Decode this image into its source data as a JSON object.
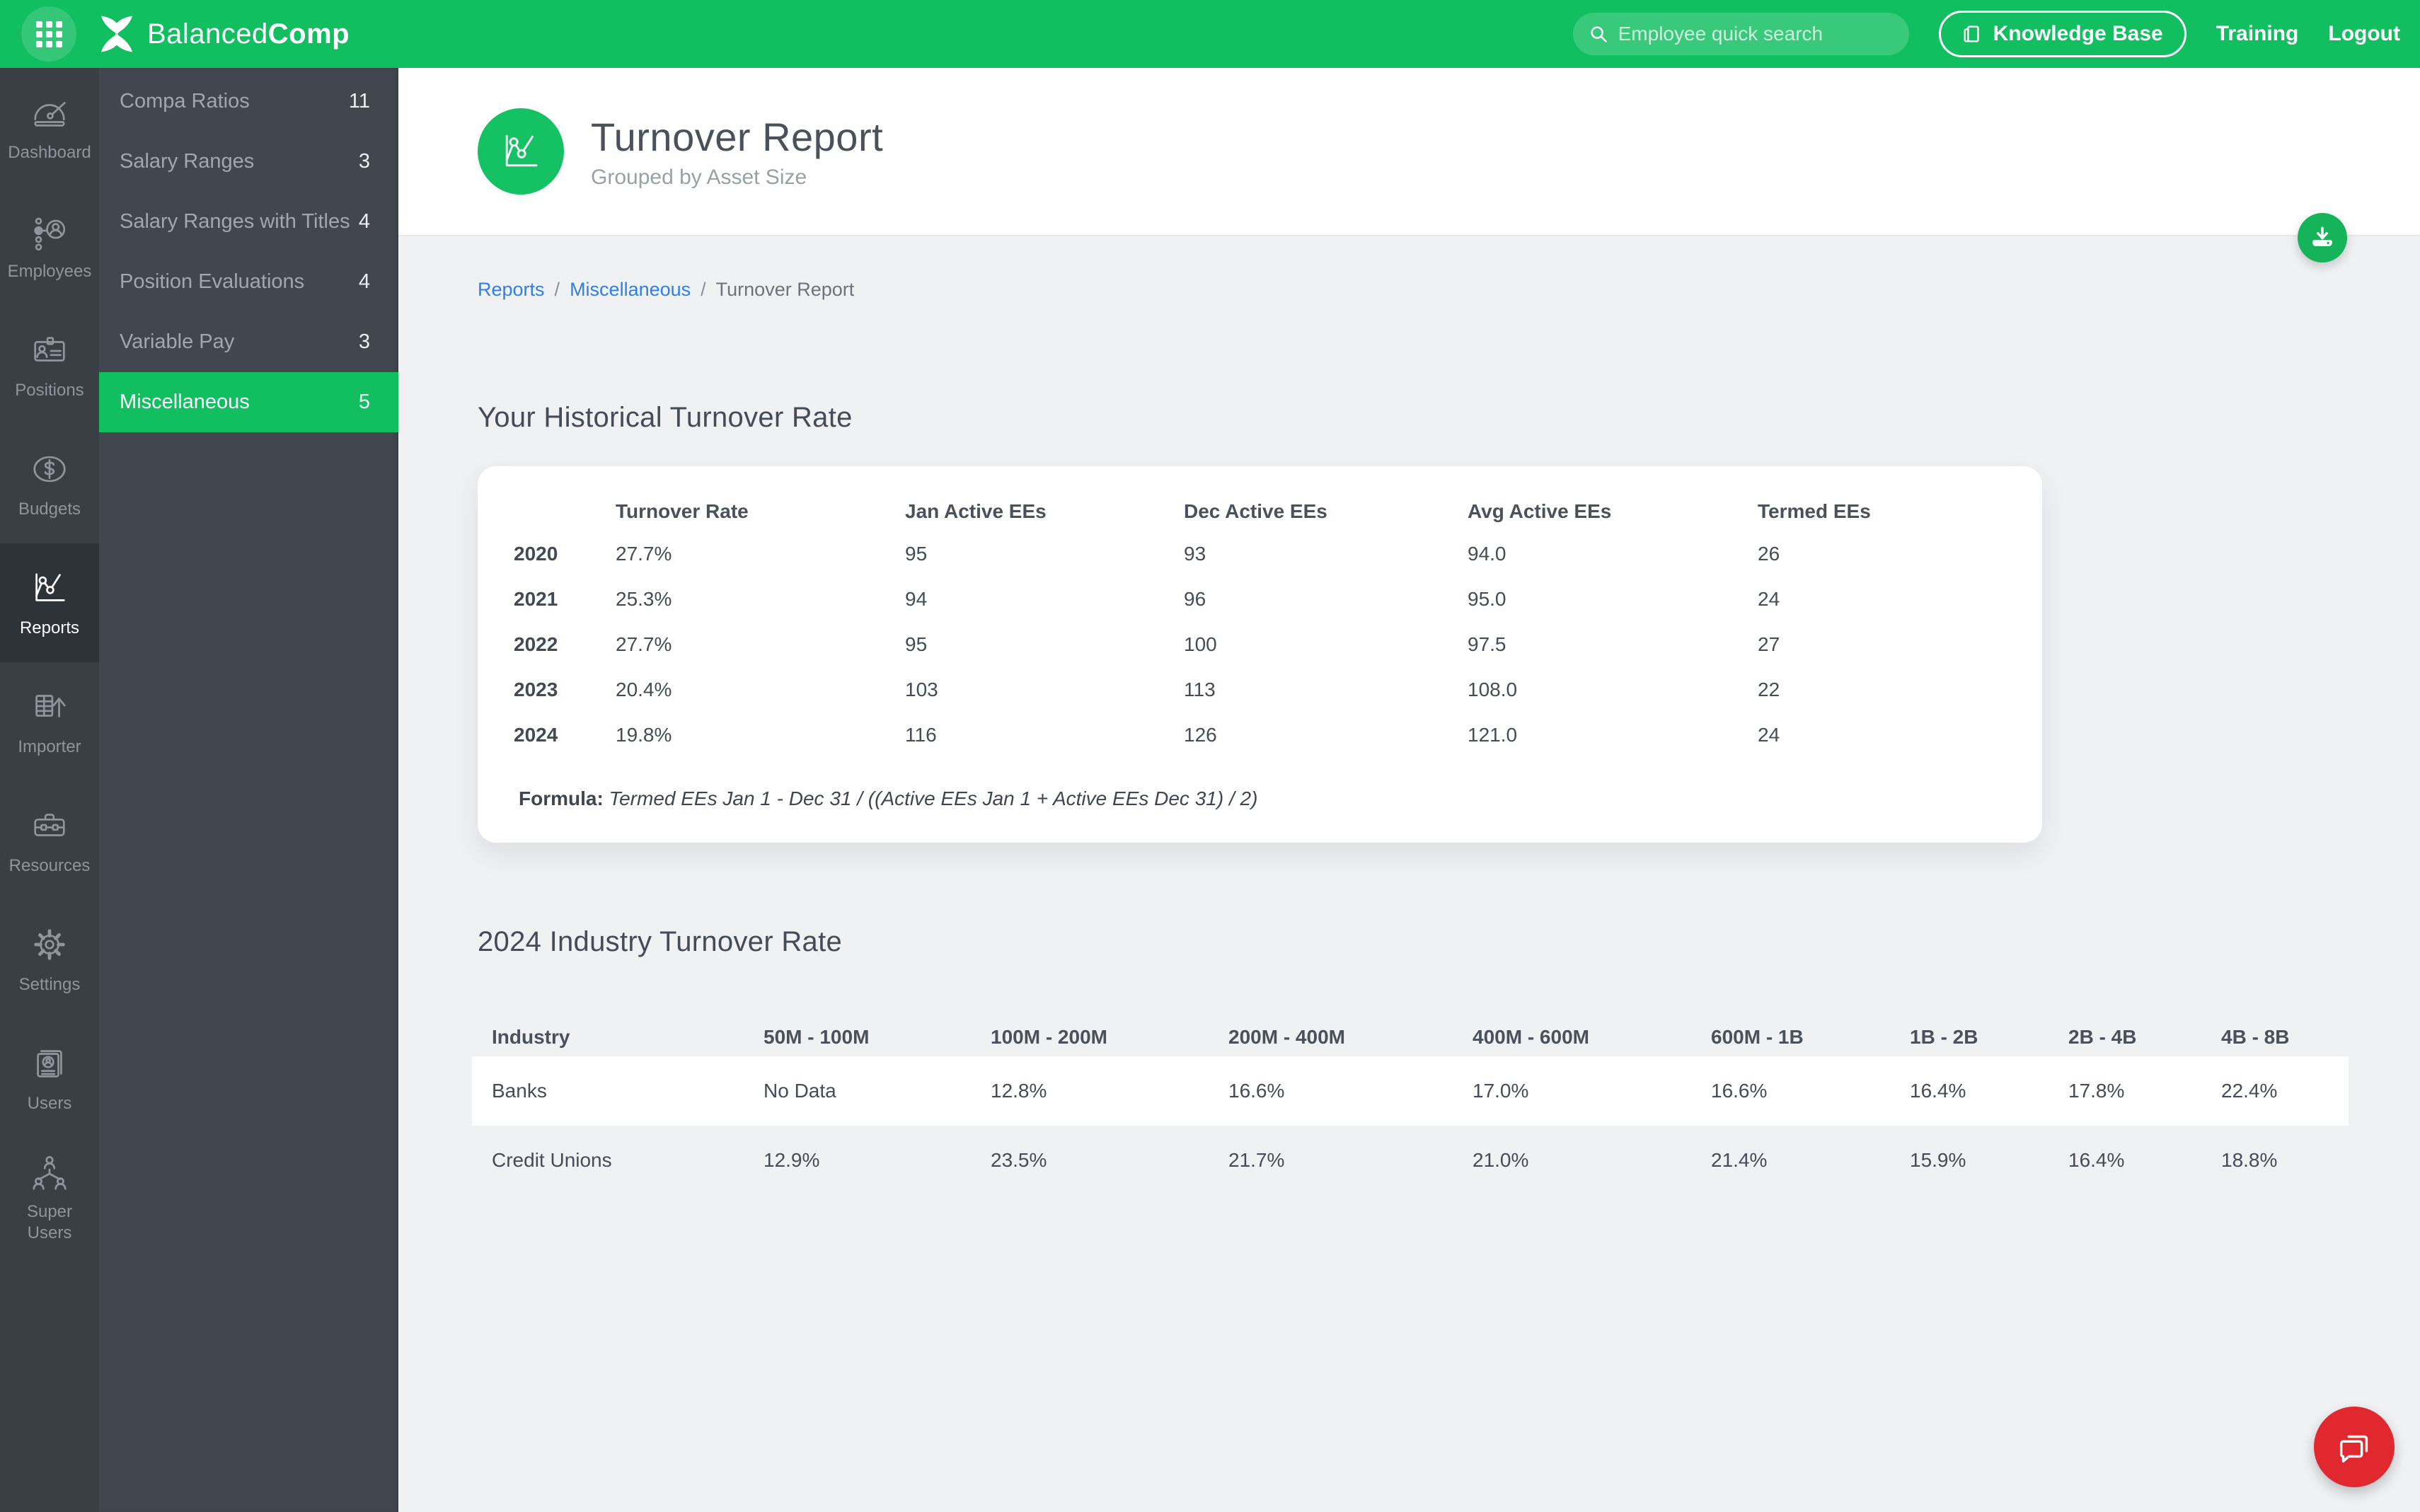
{
  "topbar": {
    "brand_regular": "Balanced",
    "brand_bold": "Comp",
    "search_placeholder": "Employee quick search",
    "knowledge_base_label": "Knowledge Base",
    "training_label": "Training",
    "logout_label": "Logout"
  },
  "sidebar": {
    "items": [
      {
        "label": "Dashboard",
        "icon": "dashboard-gauge",
        "active": false
      },
      {
        "label": "Employees",
        "icon": "employees-org",
        "active": false
      },
      {
        "label": "Positions",
        "icon": "positions-card",
        "active": false
      },
      {
        "label": "Budgets",
        "icon": "budgets-dollar",
        "active": false
      },
      {
        "label": "Reports",
        "icon": "reports-chart",
        "active": true
      },
      {
        "label": "Importer",
        "icon": "importer-sheet",
        "active": false
      },
      {
        "label": "Resources",
        "icon": "resources-briefcase",
        "active": false
      },
      {
        "label": "Settings",
        "icon": "settings-gear",
        "active": false
      },
      {
        "label": "Users",
        "icon": "users-card",
        "active": false
      },
      {
        "label": "Super Users",
        "icon": "super-users-tree",
        "active": false
      }
    ]
  },
  "submenu": {
    "items": [
      {
        "label": "Compa Ratios",
        "count": "11",
        "active": false
      },
      {
        "label": "Salary Ranges",
        "count": "3",
        "active": false
      },
      {
        "label": "Salary Ranges with Titles",
        "count": "4",
        "active": false
      },
      {
        "label": "Position Evaluations",
        "count": "4",
        "active": false
      },
      {
        "label": "Variable Pay",
        "count": "3",
        "active": false
      },
      {
        "label": "Miscellaneous",
        "count": "5",
        "active": true
      }
    ]
  },
  "header": {
    "title": "Turnover Report",
    "subtitle": "Grouped by Asset Size"
  },
  "breadcrumb": {
    "link1": "Reports",
    "link2": "Miscellaneous",
    "current": "Turnover Report",
    "separator": "/"
  },
  "historical": {
    "heading": "Your Historical Turnover Rate",
    "columns": [
      "Turnover Rate",
      "Jan Active EEs",
      "Dec Active EEs",
      "Avg Active EEs",
      "Termed EEs"
    ],
    "rows": [
      {
        "year": "2020",
        "values": [
          "27.7%",
          "95",
          "93",
          "94.0",
          "26"
        ]
      },
      {
        "year": "2021",
        "values": [
          "25.3%",
          "94",
          "96",
          "95.0",
          "24"
        ]
      },
      {
        "year": "2022",
        "values": [
          "27.7%",
          "95",
          "100",
          "97.5",
          "27"
        ]
      },
      {
        "year": "2023",
        "values": [
          "20.4%",
          "103",
          "113",
          "108.0",
          "22"
        ]
      },
      {
        "year": "2024",
        "values": [
          "19.8%",
          "116",
          "126",
          "121.0",
          "24"
        ]
      }
    ],
    "formula_label": "Formula:",
    "formula_text": "Termed EEs Jan 1 - Dec 31 / ((Active EEs Jan 1 + Active EEs Dec 31) / 2)"
  },
  "industry": {
    "heading": "2024 Industry Turnover Rate",
    "columns": [
      "Industry",
      "50M - 100M",
      "100M - 200M",
      "200M - 400M",
      "400M - 600M",
      "600M - 1B",
      "1B - 2B",
      "2B - 4B",
      "4B - 8B"
    ],
    "rows": [
      {
        "name": "Banks",
        "values": [
          "No Data",
          "12.8%",
          "16.6%",
          "17.0%",
          "16.6%",
          "16.4%",
          "17.8%",
          "22.4%"
        ]
      },
      {
        "name": "Credit Unions",
        "values": [
          "12.9%",
          "23.5%",
          "21.7%",
          "21.0%",
          "21.4%",
          "15.9%",
          "16.4%",
          "18.8%"
        ]
      }
    ]
  },
  "colors": {
    "brand_green": "#11be60",
    "chat_red": "#e1282e",
    "link_blue": "#2d7ff0"
  }
}
